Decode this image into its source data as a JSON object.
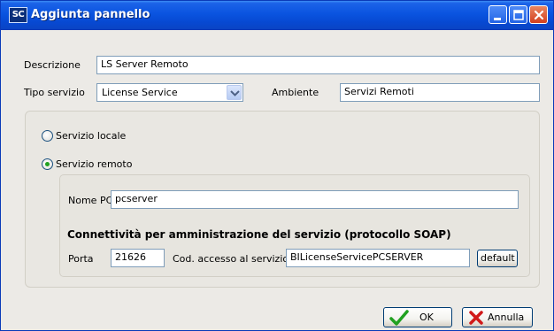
{
  "window": {
    "app_icon": "SC",
    "title": "Aggiunta pannello",
    "title_icon": "app-sc-icon",
    "controls": [
      "minimize-icon",
      "maximize-icon",
      "close-icon"
    ]
  },
  "form": {
    "descrizione_label": "Descrizione",
    "descrizione_value": "LS Server Remoto",
    "tipo_servizio_label": "Tipo servizio",
    "tipo_servizio_value": "License Service",
    "ambiente_label": "Ambiente",
    "ambiente_value": "Servizi Remoti"
  },
  "service_mode": {
    "local_label": "Servizio locale",
    "local_selected": false,
    "remote_label": "Servizio remoto",
    "remote_selected": true
  },
  "remote": {
    "nome_pc_label": "Nome PC",
    "nome_pc_value": "pcserver",
    "section_title": "Connettività per amministrazione del servizio (protocollo SOAP)",
    "porta_label": "Porta",
    "porta_value": "21626",
    "cod_accesso_label": "Cod. accesso al servizio",
    "cod_accesso_value": "BILicenseServicePCSERVER",
    "default_label": "default"
  },
  "buttons": {
    "ok_label": "OK",
    "cancel_label": "Annulla"
  },
  "colors": {
    "titlebar": "#0a54e0",
    "dialog_bg": "#eceae6",
    "input_border": "#7f9db9",
    "ok_check": "#21a121",
    "cancel_x": "#d11a1a"
  }
}
